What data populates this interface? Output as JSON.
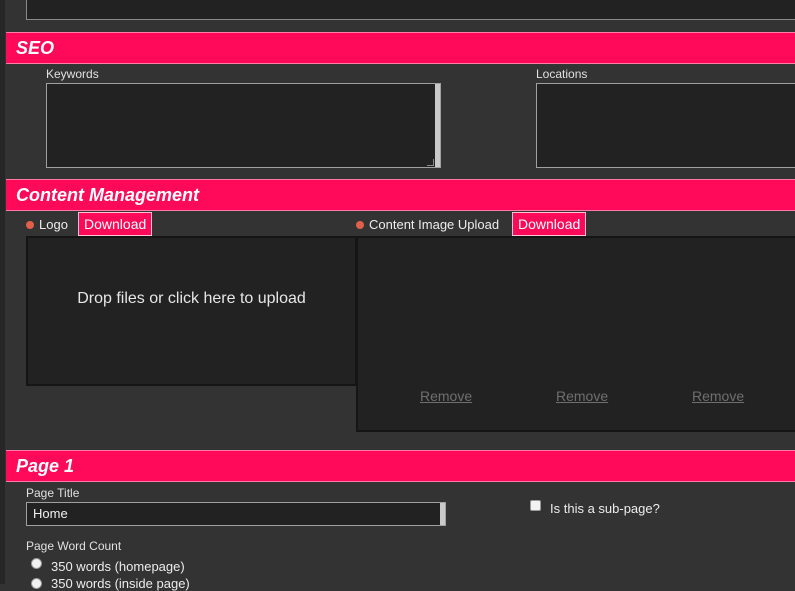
{
  "seo": {
    "title": "SEO",
    "keywords_label": "Keywords",
    "keywords_value": "",
    "locations_label": "Locations",
    "locations_value": ""
  },
  "content_management": {
    "title": "Content Management",
    "logo": {
      "label": "Logo",
      "download_label": "Download",
      "drop_text": "Drop files or click here to upload"
    },
    "content_image": {
      "label": "Content Image Upload",
      "download_label": "Download",
      "remove_labels": [
        "Remove",
        "Remove",
        "Remove"
      ]
    }
  },
  "page1": {
    "title": "Page 1",
    "page_title_label": "Page Title",
    "page_title_value": "Home",
    "subpage_label": "Is this a sub-page?",
    "subpage_checked": false,
    "word_count_label": "Page Word Count",
    "word_count_options": [
      "350 words (homepage)",
      "350 words (inside page)"
    ]
  },
  "colors": {
    "accent": "#ff0a5a",
    "background": "#333333",
    "field_background": "#222222",
    "indicator_dot": "#e0604a"
  }
}
